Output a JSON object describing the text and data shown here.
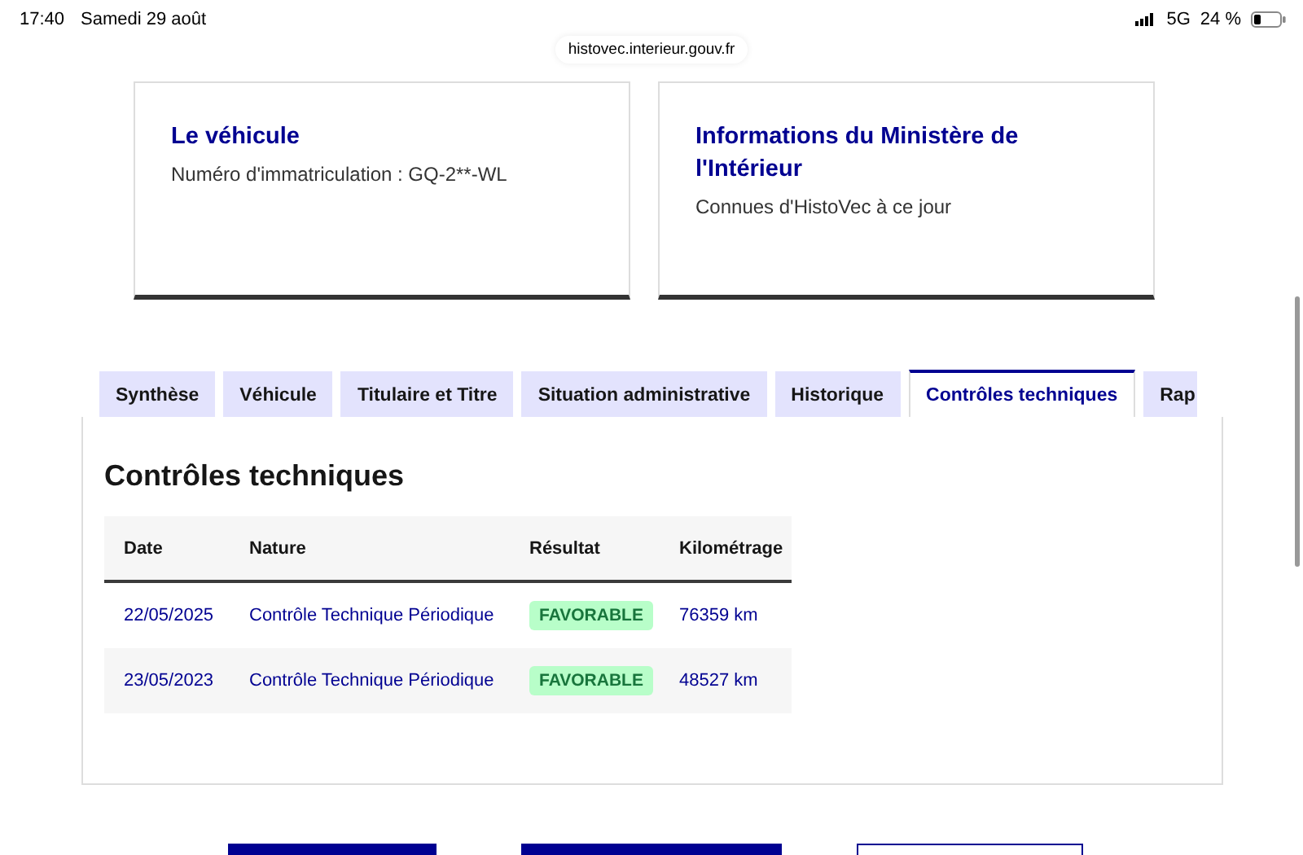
{
  "status_bar": {
    "time": "17:40",
    "date": "Samedi 29 août",
    "network": "5G",
    "battery": "24 %"
  },
  "address_bar": {
    "url": "histovec.interieur.gouv.fr"
  },
  "cards": [
    {
      "title": "Le véhicule",
      "text": "Numéro d'immatriculation : GQ-2**-WL"
    },
    {
      "title": "Informations du Ministère de l'Intérieur",
      "text": "Connues d'HistoVec à ce jour"
    }
  ],
  "tabs": [
    {
      "label": "Synthèse",
      "selected": false
    },
    {
      "label": "Véhicule",
      "selected": false
    },
    {
      "label": "Titulaire et Titre",
      "selected": false
    },
    {
      "label": "Situation administrative",
      "selected": false
    },
    {
      "label": "Historique",
      "selected": false
    },
    {
      "label": "Contrôles techniques",
      "selected": true
    },
    {
      "label": "Rap",
      "selected": false
    }
  ],
  "panel": {
    "title": "Contrôles techniques",
    "table": {
      "columns": [
        "Date",
        "Nature",
        "Résultat",
        "Kilométrage"
      ],
      "rows": [
        [
          "22/05/2025",
          "Contrôle Technique Périodique",
          "FAVORABLE",
          "76359 km"
        ],
        [
          "23/05/2023",
          "Contrôle Technique Périodique",
          "FAVORABLE",
          "48527 km"
        ]
      ]
    }
  }
}
